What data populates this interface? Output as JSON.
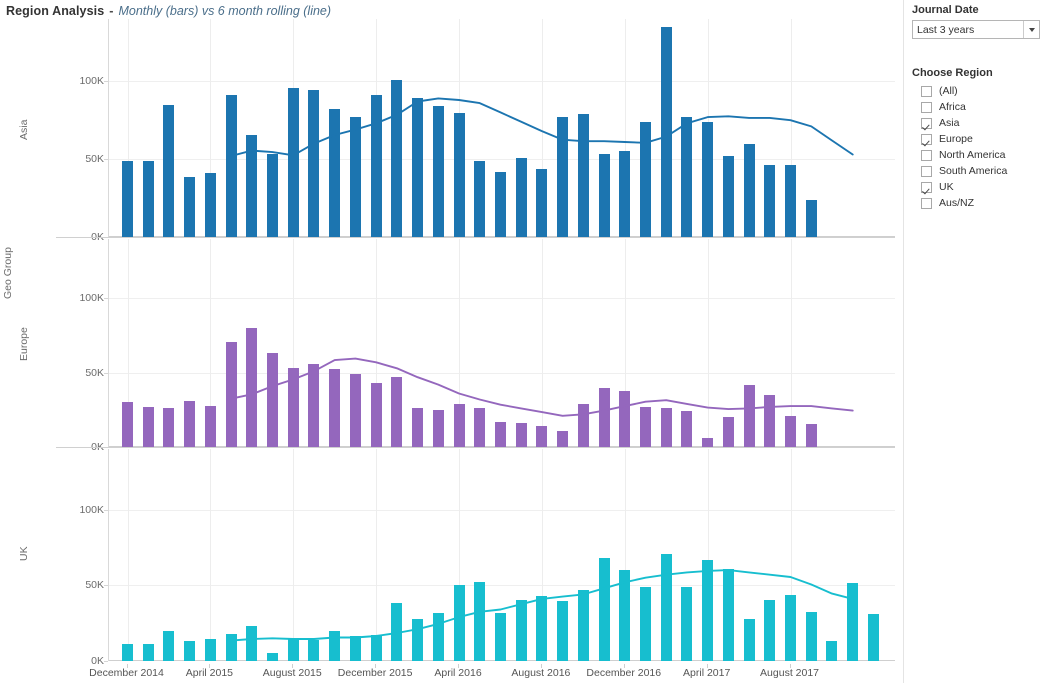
{
  "title": {
    "main": "Region Analysis",
    "separator": "-",
    "subtitle": "Monthly (bars) vs 6 month rolling (line)"
  },
  "axis": {
    "group_label": "Geo Group",
    "y_ticks": [
      "100K",
      "50K",
      "0K"
    ],
    "y_tick_values": [
      100000,
      50000,
      0
    ],
    "y_max": 140000,
    "x_tick_labels": [
      "December 2014",
      "April 2015",
      "August 2015",
      "December 2015",
      "April 2016",
      "August 2016",
      "December 2016",
      "April 2017",
      "August 2017"
    ]
  },
  "filters": {
    "date": {
      "label": "Journal Date",
      "selected": "Last 3 years",
      "options": [
        "Last 3 years"
      ],
      "caret_icon": "chevron-down-icon"
    },
    "region": {
      "label": "Choose Region",
      "items": [
        {
          "label": "(All)",
          "checked": false
        },
        {
          "label": "Africa",
          "checked": false
        },
        {
          "label": "Asia",
          "checked": true
        },
        {
          "label": "Europe",
          "checked": true
        },
        {
          "label": "North America",
          "checked": false
        },
        {
          "label": "South America",
          "checked": false
        },
        {
          "label": "UK",
          "checked": true
        },
        {
          "label": "Aus/NZ",
          "checked": false
        }
      ]
    }
  },
  "chart_data": {
    "type": "bar",
    "title": "Region Analysis - Monthly (bars) vs 6 month rolling (line)",
    "xlabel": "",
    "ylabel": "Geo Group",
    "ylim": [
      0,
      140000
    ],
    "grid": true,
    "legend": "none",
    "x": [
      "December 2014",
      "January 2015",
      "February 2015",
      "March 2015",
      "April 2015",
      "May 2015",
      "June 2015",
      "July 2015",
      "August 2015",
      "September 2015",
      "October 2015",
      "November 2015",
      "December 2015",
      "January 2016",
      "February 2016",
      "March 2016",
      "April 2016",
      "May 2016",
      "June 2016",
      "July 2016",
      "August 2016",
      "September 2016",
      "October 2016",
      "November 2016",
      "December 2016",
      "January 2017",
      "February 2017",
      "March 2017",
      "April 2017",
      "May 2017",
      "June 2017",
      "July 2017",
      "August 2017",
      "September 2017",
      "October 2017",
      "November 2017"
    ],
    "panels": [
      {
        "name": "Asia",
        "color": "#1C75B0",
        "line_color": "#1C75B0",
        "bars": [
          49000,
          49000,
          85000,
          38500,
          41000,
          91500,
          65500,
          53500,
          96000,
          94500,
          82000,
          77000,
          91000,
          101000,
          89000,
          84000,
          79500,
          48500,
          41500,
          50500,
          44000,
          77000,
          79000,
          53000,
          55500,
          74000,
          135000,
          77000,
          74000,
          52000,
          60000,
          46000,
          46500,
          23500,
          0,
          0
        ],
        "line": [
          null,
          null,
          null,
          null,
          null,
          52000,
          55500,
          54500,
          52500,
          60000,
          65500,
          69000,
          73000,
          78500,
          87000,
          89000,
          88000,
          86000,
          80000,
          74000,
          68000,
          62500,
          61500,
          61500,
          61000,
          60500,
          64500,
          73000,
          77000,
          77500,
          76500,
          76500,
          75000,
          71000,
          62000,
          53000
        ]
      },
      {
        "name": "Europe",
        "color": "#9467BD",
        "line_color": "#9467BD",
        "bars": [
          30500,
          27000,
          26500,
          31000,
          27500,
          71000,
          80000,
          63500,
          53500,
          56000,
          52500,
          49000,
          43000,
          47000,
          26500,
          25000,
          29000,
          26500,
          17000,
          16000,
          14000,
          11000,
          29000,
          40000,
          37500,
          27000,
          26500,
          24500,
          6000,
          20500,
          42000,
          35000,
          21000,
          15500,
          0,
          0
        ],
        "line": [
          null,
          null,
          null,
          null,
          null,
          32500,
          35500,
          41000,
          45500,
          51000,
          58500,
          59500,
          57000,
          53000,
          47000,
          42000,
          36000,
          32000,
          28500,
          26000,
          23500,
          21000,
          22000,
          24500,
          27500,
          30500,
          31500,
          29000,
          26500,
          25500,
          26000,
          27000,
          27500,
          27500,
          26000,
          24500
        ]
      },
      {
        "name": "UK",
        "color": "#17BECF",
        "line_color": "#17BECF",
        "bars": [
          11500,
          11000,
          19500,
          13500,
          14500,
          18000,
          23000,
          5000,
          14500,
          14000,
          19500,
          16500,
          17000,
          38000,
          28000,
          32000,
          50500,
          52000,
          32000,
          40500,
          43000,
          39500,
          47000,
          68000,
          60000,
          49000,
          70500,
          49000,
          67000,
          60500,
          28000,
          40500,
          43500,
          32500,
          13000,
          51500,
          31000
        ],
        "line": [
          null,
          null,
          null,
          null,
          null,
          13500,
          14500,
          15000,
          14500,
          14500,
          15500,
          15500,
          16500,
          18500,
          21000,
          24500,
          29000,
          32500,
          34000,
          37500,
          41000,
          42500,
          44000,
          48000,
          52000,
          55000,
          57000,
          58500,
          59500,
          60000,
          58500,
          57000,
          55500,
          50500,
          44500,
          41000
        ]
      }
    ]
  }
}
